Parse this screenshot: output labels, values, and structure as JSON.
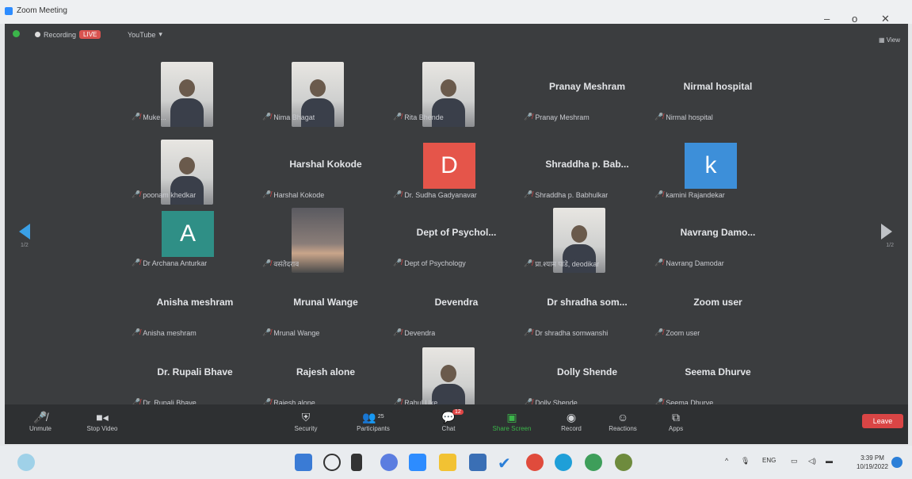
{
  "window": {
    "title": "Zoom Meeting",
    "minimize": "–",
    "restore": "o",
    "close": "✕"
  },
  "topbar": {
    "recording_label": "Recording",
    "recording_badge": "LIVE",
    "youtube_label": "YouTube",
    "view_label": "View"
  },
  "tiles": [
    {
      "kind": "photo",
      "label": "Muke..."
    },
    {
      "kind": "photo",
      "label": "Nima Bhagat"
    },
    {
      "kind": "photo",
      "label": "Rita Bhende"
    },
    {
      "kind": "name",
      "display": "Pranay Meshram",
      "label": "Pranay Meshram"
    },
    {
      "kind": "name",
      "display": "Nirmal hospital",
      "label": "Nirmal hospital"
    },
    {
      "kind": "photo",
      "label": "poonam khedkar"
    },
    {
      "kind": "name",
      "display": "Harshal Kokode",
      "label": "Harshal Kokode"
    },
    {
      "kind": "letter",
      "letter": "D",
      "color": "#e5554a",
      "label": "Dr. Sudha Gadyanavar"
    },
    {
      "kind": "name",
      "display": "Shraddha p. Bab...",
      "label": "Shraddha p. Babhulkar"
    },
    {
      "kind": "letter",
      "letter": "k",
      "color": "#3d8fd9",
      "label": "kamini Rajandekar"
    },
    {
      "kind": "letter",
      "letter": "A",
      "color": "#2f8f86",
      "label": "Dr Archana Anturkar"
    },
    {
      "kind": "sunset",
      "label": "वसंतेदराव"
    },
    {
      "kind": "name",
      "display": "Dept of Psychol...",
      "label": "Dept of Psychology"
    },
    {
      "kind": "photo",
      "label": "प्रा.श्याम पांडे, deodikar"
    },
    {
      "kind": "name",
      "display": "Navrang Damo...",
      "label": "Navrang Damodar"
    },
    {
      "kind": "name",
      "display": "Anisha meshram",
      "label": "Anisha meshram"
    },
    {
      "kind": "name",
      "display": "Mrunal Wange",
      "label": "Mrunal Wange"
    },
    {
      "kind": "name",
      "display": "Devendra",
      "label": "Devendra"
    },
    {
      "kind": "name",
      "display": "Dr shradha som...",
      "label": "Dr shradha somwanshi"
    },
    {
      "kind": "name",
      "display": "Zoom user",
      "label": "Zoom user"
    },
    {
      "kind": "name",
      "display": "Dr. Rupali Bhave",
      "label": "Dr. Rupali Bhave"
    },
    {
      "kind": "name",
      "display": "Rajesh alone",
      "label": "Rajesh alone"
    },
    {
      "kind": "photo",
      "label": "Rahul Uke"
    },
    {
      "kind": "name",
      "display": "Dolly Shende",
      "label": "Dolly Shende"
    },
    {
      "kind": "name",
      "display": "Seema Dhurve",
      "label": "Seema Dhurve"
    }
  ],
  "toolbar": {
    "unmute": "Unmute",
    "stop_video": "Stop Video",
    "security": "Security",
    "participants": "Participants",
    "participants_count": "25",
    "chat": "Chat",
    "chat_badge": "12",
    "share": "Share Screen",
    "record": "Record",
    "reactions": "Reactions",
    "apps": "Apps",
    "leave": "Leave"
  },
  "taskbar": {
    "lang": "ENG",
    "time": "3:39 PM",
    "date": "10/19/2022"
  }
}
